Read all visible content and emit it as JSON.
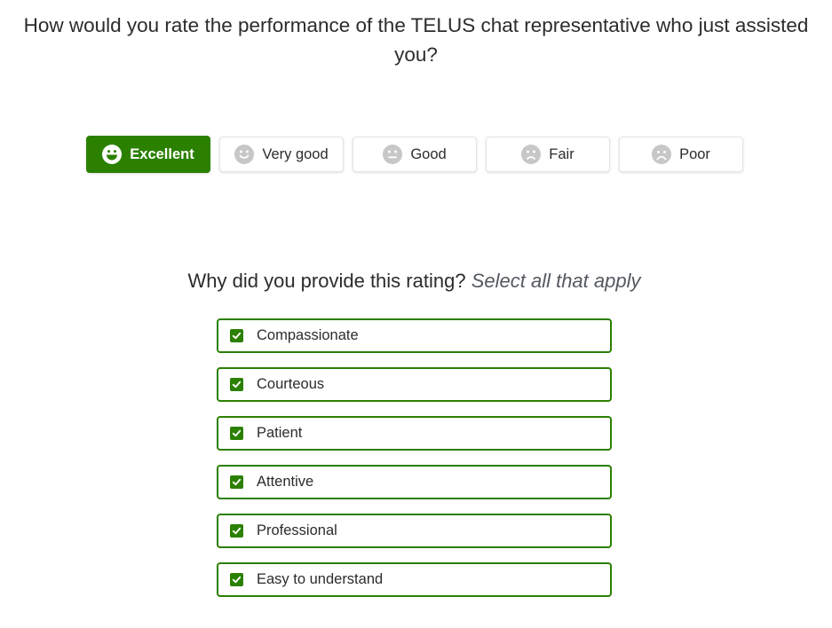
{
  "question": "How would you rate the performance of the TELUS chat representative who just assisted you?",
  "ratings": [
    {
      "label": "Excellent",
      "icon": "laughing-face-icon",
      "selected": true
    },
    {
      "label": "Very good",
      "icon": "smiling-face-icon",
      "selected": false
    },
    {
      "label": "Good",
      "icon": "neutral-face-icon",
      "selected": false
    },
    {
      "label": "Fair",
      "icon": "frowning-face-icon",
      "selected": false
    },
    {
      "label": "Poor",
      "icon": "sad-face-icon",
      "selected": false
    }
  ],
  "reasons": {
    "title": "Why did you provide this rating?",
    "hint": "Select all that apply",
    "options": [
      {
        "label": "Compassionate",
        "checked": true
      },
      {
        "label": "Courteous",
        "checked": true
      },
      {
        "label": "Patient",
        "checked": true
      },
      {
        "label": "Attentive",
        "checked": true
      },
      {
        "label": "Professional",
        "checked": true
      },
      {
        "label": "Easy to understand",
        "checked": true
      }
    ]
  },
  "colors": {
    "accent": "#2b8000",
    "text": "#2a2c2e",
    "face_inactive": "#c7c7c7"
  }
}
